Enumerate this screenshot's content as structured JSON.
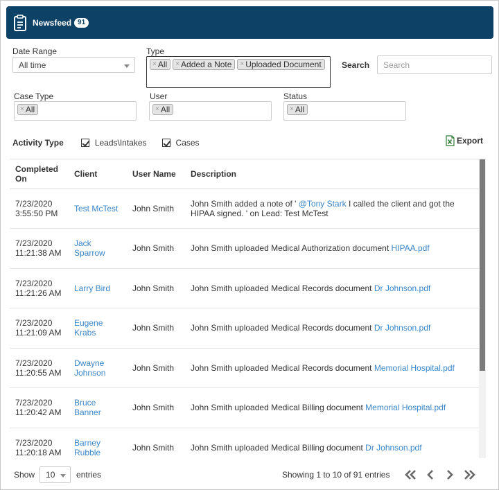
{
  "header": {
    "title": "Newsfeed",
    "badge": "91"
  },
  "filters": {
    "date_range": {
      "label": "Date Range",
      "value": "All time"
    },
    "type": {
      "label": "Type",
      "chips": [
        "All",
        "Added a Note",
        "Uploaded Document"
      ]
    },
    "search": {
      "label": "Search",
      "placeholder": "Search"
    },
    "case_type": {
      "label": "Case Type",
      "chips": [
        "All"
      ]
    },
    "user": {
      "label": "User",
      "chips": [
        "All"
      ]
    },
    "status": {
      "label": "Status",
      "chips": [
        "All"
      ]
    }
  },
  "activity": {
    "label": "Activity Type",
    "options": [
      {
        "label": "Leads\\Intakes",
        "checked": true
      },
      {
        "label": "Cases",
        "checked": true
      }
    ],
    "export_label": "Export"
  },
  "table": {
    "columns": [
      "Completed On",
      "Client",
      "User Name",
      "Description"
    ],
    "rows": [
      {
        "date": "7/23/2020 3:55:50 PM",
        "client": "Test McTest",
        "user": "John Smith",
        "desc_pre": "John Smith added a note of ' ",
        "desc_link": "@Tony Stark",
        "desc_post": " I called the client and got the HIPAA signed. ' on Lead: Test McTest"
      },
      {
        "date": "7/23/2020 11:21:38 AM",
        "client": "Jack Sparrow",
        "user": "John Smith",
        "desc_pre": "John Smith uploaded Medical Authorization document ",
        "desc_link": "HIPAA.pdf",
        "desc_post": ""
      },
      {
        "date": "7/23/2020 11:21:26 AM",
        "client": "Larry Bird",
        "user": "John Smith",
        "desc_pre": "John Smith uploaded Medical Records document ",
        "desc_link": "Dr Johnson.pdf",
        "desc_post": ""
      },
      {
        "date": "7/23/2020 11:21:09 AM",
        "client": "Eugene Krabs",
        "user": "John Smith",
        "desc_pre": "John Smith uploaded Medical Records document ",
        "desc_link": "Dr Johnson.pdf",
        "desc_post": ""
      },
      {
        "date": "7/23/2020 11:20:55 AM",
        "client": "Dwayne Johnson",
        "user": "John Smith",
        "desc_pre": "John Smith uploaded Medical Records document ",
        "desc_link": "Memorial Hospital.pdf",
        "desc_post": ""
      },
      {
        "date": "7/23/2020 11:20:42 AM",
        "client": "Bruce Banner",
        "user": "John Smith",
        "desc_pre": "John Smith uploaded Medical Billing document ",
        "desc_link": "Memorial Hospital.pdf",
        "desc_post": ""
      },
      {
        "date": "7/23/2020 11:20:18 AM",
        "client": "Barney Rubble",
        "user": "John Smith",
        "desc_pre": "John Smith uploaded Medical Billing document ",
        "desc_link": "Dr Johnson.pdf",
        "desc_post": ""
      }
    ]
  },
  "footer": {
    "show_label": "Show",
    "page_length": "10",
    "entries_label": "entries",
    "info": "Showing 1 to 10 of 91 entries"
  },
  "colors": {
    "header_bg": "#0e4166",
    "link": "#3a86c8",
    "export_icon": "#2e7d32"
  },
  "icons": {
    "header": "clipboard-icon",
    "export": "excel-icon"
  }
}
